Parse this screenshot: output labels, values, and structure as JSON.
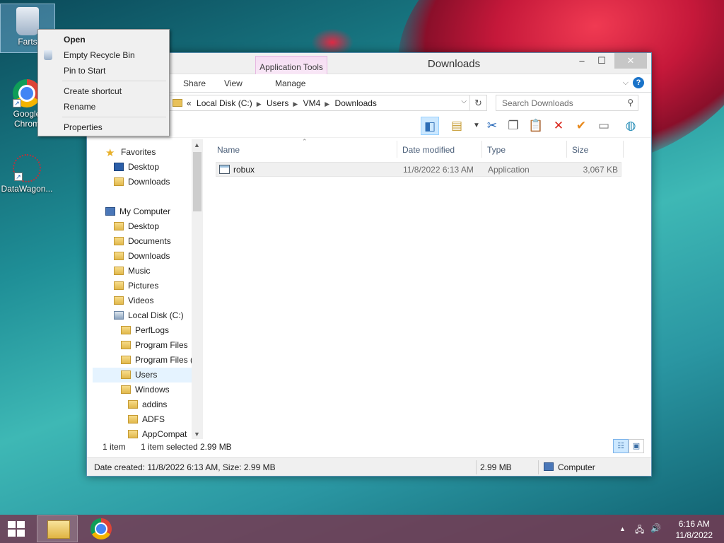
{
  "desktop": {
    "icons": [
      {
        "label": "Farts"
      },
      {
        "label": "Google Chrome",
        "line1": "Google",
        "line2": "Chrom"
      },
      {
        "label": "DataWagon..."
      }
    ]
  },
  "context_menu": {
    "items": [
      "Open",
      "Empty Recycle Bin",
      "Pin to Start",
      "Create shortcut",
      "Rename",
      "Properties"
    ]
  },
  "window": {
    "title": "Downloads",
    "context_tab_group": "Application Tools",
    "controls": {
      "minimize": "–",
      "maximize": "☐",
      "close": "✕"
    },
    "ribbon_tabs": [
      "Share",
      "View",
      "Manage"
    ],
    "address": {
      "overflow": "«",
      "crumbs": [
        "Local Disk (C:)",
        "Users",
        "VM4",
        "Downloads"
      ],
      "separator": "▶"
    },
    "search": {
      "placeholder": "Search Downloads"
    },
    "columns": [
      "Name",
      "Date modified",
      "Type",
      "Size"
    ],
    "files": [
      {
        "name": "robux",
        "date_modified": "11/8/2022 6:13 AM",
        "type": "Application",
        "size": "3,067 KB"
      }
    ],
    "nav": {
      "favorites_label": "Favorites",
      "favorites": [
        "Desktop",
        "Downloads"
      ],
      "computer_label": "My Computer",
      "computer": [
        "Desktop",
        "Documents",
        "Downloads",
        "Music",
        "Pictures",
        "Videos",
        "Local Disk (C:)"
      ],
      "drive": [
        "PerfLogs",
        "Program Files",
        "Program Files (",
        "Users",
        "Windows"
      ],
      "windows": [
        "addins",
        "ADFS",
        "AppCompat"
      ]
    },
    "status": {
      "item_count": "1 item",
      "selected": "1 item selected",
      "selected_size": "2.99 MB"
    },
    "details": {
      "text": "Date created: 11/8/2022 6:13 AM, Size: 2.99 MB",
      "size": "2.99 MB",
      "location": "Computer"
    }
  },
  "taskbar": {
    "clock_time": "6:16 AM",
    "clock_date": "11/8/2022"
  },
  "colors": {
    "accent": "#1a73c9",
    "selection": "#cce8ff",
    "taskbar": "#763a52",
    "context_tab": "#f6ddf3"
  }
}
